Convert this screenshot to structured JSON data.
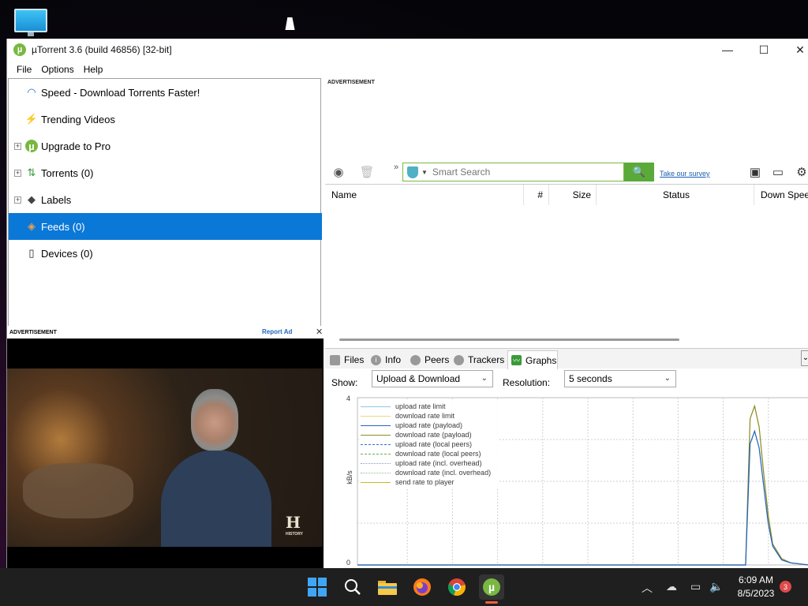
{
  "window": {
    "title": "µTorrent 3.6  (build 46856) [32-bit]",
    "min": "—",
    "max": "☐",
    "close": "✕"
  },
  "menubar": [
    "File",
    "Options",
    "Help"
  ],
  "nav": [
    {
      "label": "Speed - Download Torrents Faster!",
      "icon": "speedometer-icon",
      "glyph": "◠"
    },
    {
      "label": "Trending Videos",
      "icon": "bolt-icon",
      "glyph": "⚡"
    },
    {
      "label": "Upgrade to Pro",
      "icon": "utorrent-icon",
      "glyph": "µ",
      "expander": "+"
    },
    {
      "label": "Torrents (0)",
      "icon": "up-down-arrows-icon",
      "glyph": "⇅",
      "expander": "+"
    },
    {
      "label": "Labels",
      "icon": "tag-icon",
      "glyph": "◆",
      "expander": "+"
    },
    {
      "label": "Feeds (0)",
      "icon": "rss-icon",
      "glyph": "◈",
      "selected": true
    },
    {
      "label": "Devices (0)",
      "icon": "device-icon",
      "glyph": "▯"
    }
  ],
  "ad": {
    "label": "ADVERTISEMENT",
    "report": "Report Ad",
    "close": "✕",
    "video_logo": "H",
    "video_logo_sub": "HISTORY"
  },
  "right_ad": {
    "label": "ADVERTISEMENT"
  },
  "toolbar": {
    "rss": "◉",
    "trash": "🗑",
    "more": "»",
    "search_placeholder": "Smart Search",
    "search_button": "🔍",
    "survey": "Take our survey",
    "chat": "▣",
    "remote": "▭",
    "settings": "⚙"
  },
  "table": {
    "columns": [
      "Name",
      "#",
      "Size",
      "Status",
      "Down Speed"
    ]
  },
  "tabs": [
    "Files",
    "Info",
    "Peers",
    "Trackers",
    "Graphs"
  ],
  "graph_controls": {
    "show_label": "Show:",
    "show_value": "Upload & Download",
    "resolution_label": "Resolution:",
    "resolution_value": "5 seconds"
  },
  "chart_data": {
    "type": "line",
    "ylabel": "kB/s",
    "ylim": [
      0,
      4
    ],
    "ytick_labels": [
      "4",
      "0"
    ],
    "legend": [
      {
        "name": "upload rate limit",
        "color": "#88c8e8",
        "style": "solid"
      },
      {
        "name": "download rate limit",
        "color": "#e8d888",
        "style": "solid"
      },
      {
        "name": "upload rate (payload)",
        "color": "#1f5fbf",
        "style": "solid"
      },
      {
        "name": "download rate (payload)",
        "color": "#8a8a1a",
        "style": "solid"
      },
      {
        "name": "upload rate (local peers)",
        "color": "#2a6ad0",
        "style": "dashed"
      },
      {
        "name": "download rate (local peers)",
        "color": "#5ab04a",
        "style": "dashed"
      },
      {
        "name": "upload rate (incl. overhead)",
        "color": "#7aa0c0",
        "style": "dotted"
      },
      {
        "name": "download rate (incl. overhead)",
        "color": "#8abf8a",
        "style": "dotted"
      },
      {
        "name": "send rate to player",
        "color": "#c8b818",
        "style": "solid"
      }
    ],
    "series": [
      {
        "name": "download rate (payload)",
        "points": [
          [
            0,
            0
          ],
          [
            86,
            0
          ],
          [
            87,
            3.5
          ],
          [
            88,
            3.8
          ],
          [
            89,
            3.3
          ],
          [
            90,
            2.2
          ],
          [
            91,
            1.2
          ],
          [
            92,
            0.5
          ],
          [
            94,
            0.15
          ],
          [
            96,
            0.05
          ],
          [
            100,
            0
          ]
        ]
      },
      {
        "name": "upload rate (payload)",
        "points": [
          [
            0,
            0
          ],
          [
            86,
            0
          ],
          [
            87,
            2.9
          ],
          [
            88,
            3.2
          ],
          [
            89,
            2.8
          ],
          [
            90,
            1.9
          ],
          [
            91,
            1.0
          ],
          [
            92,
            0.45
          ],
          [
            94,
            0.12
          ],
          [
            96,
            0.05
          ],
          [
            100,
            0
          ]
        ]
      }
    ],
    "grid": true
  },
  "taskbar": {
    "time": "6:09 AM",
    "date": "8/5/2023",
    "notifications": "3",
    "apps": [
      "start-icon",
      "search-icon",
      "file-explorer-icon",
      "firefox-icon",
      "chrome-icon",
      "utorrent-icon"
    ]
  }
}
